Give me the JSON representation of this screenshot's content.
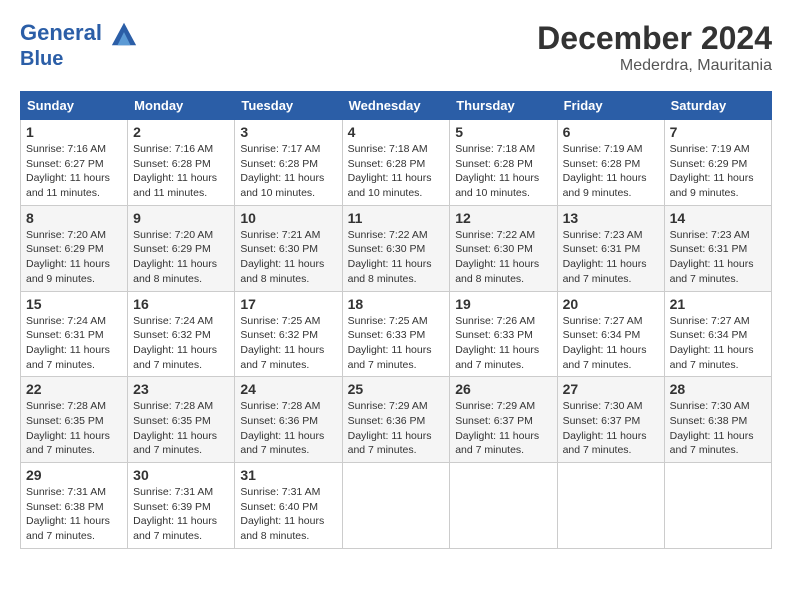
{
  "header": {
    "logo_line1": "General",
    "logo_line2": "Blue",
    "month": "December 2024",
    "location": "Mederdra, Mauritania"
  },
  "days_of_week": [
    "Sunday",
    "Monday",
    "Tuesday",
    "Wednesday",
    "Thursday",
    "Friday",
    "Saturday"
  ],
  "weeks": [
    [
      {
        "day": "1",
        "sunrise": "7:16 AM",
        "sunset": "6:27 PM",
        "daylight": "11 hours and 11 minutes."
      },
      {
        "day": "2",
        "sunrise": "7:16 AM",
        "sunset": "6:28 PM",
        "daylight": "11 hours and 11 minutes."
      },
      {
        "day": "3",
        "sunrise": "7:17 AM",
        "sunset": "6:28 PM",
        "daylight": "11 hours and 10 minutes."
      },
      {
        "day": "4",
        "sunrise": "7:18 AM",
        "sunset": "6:28 PM",
        "daylight": "11 hours and 10 minutes."
      },
      {
        "day": "5",
        "sunrise": "7:18 AM",
        "sunset": "6:28 PM",
        "daylight": "11 hours and 10 minutes."
      },
      {
        "day": "6",
        "sunrise": "7:19 AM",
        "sunset": "6:28 PM",
        "daylight": "11 hours and 9 minutes."
      },
      {
        "day": "7",
        "sunrise": "7:19 AM",
        "sunset": "6:29 PM",
        "daylight": "11 hours and 9 minutes."
      }
    ],
    [
      {
        "day": "8",
        "sunrise": "7:20 AM",
        "sunset": "6:29 PM",
        "daylight": "11 hours and 9 minutes."
      },
      {
        "day": "9",
        "sunrise": "7:20 AM",
        "sunset": "6:29 PM",
        "daylight": "11 hours and 8 minutes."
      },
      {
        "day": "10",
        "sunrise": "7:21 AM",
        "sunset": "6:30 PM",
        "daylight": "11 hours and 8 minutes."
      },
      {
        "day": "11",
        "sunrise": "7:22 AM",
        "sunset": "6:30 PM",
        "daylight": "11 hours and 8 minutes."
      },
      {
        "day": "12",
        "sunrise": "7:22 AM",
        "sunset": "6:30 PM",
        "daylight": "11 hours and 8 minutes."
      },
      {
        "day": "13",
        "sunrise": "7:23 AM",
        "sunset": "6:31 PM",
        "daylight": "11 hours and 7 minutes."
      },
      {
        "day": "14",
        "sunrise": "7:23 AM",
        "sunset": "6:31 PM",
        "daylight": "11 hours and 7 minutes."
      }
    ],
    [
      {
        "day": "15",
        "sunrise": "7:24 AM",
        "sunset": "6:31 PM",
        "daylight": "11 hours and 7 minutes."
      },
      {
        "day": "16",
        "sunrise": "7:24 AM",
        "sunset": "6:32 PM",
        "daylight": "11 hours and 7 minutes."
      },
      {
        "day": "17",
        "sunrise": "7:25 AM",
        "sunset": "6:32 PM",
        "daylight": "11 hours and 7 minutes."
      },
      {
        "day": "18",
        "sunrise": "7:25 AM",
        "sunset": "6:33 PM",
        "daylight": "11 hours and 7 minutes."
      },
      {
        "day": "19",
        "sunrise": "7:26 AM",
        "sunset": "6:33 PM",
        "daylight": "11 hours and 7 minutes."
      },
      {
        "day": "20",
        "sunrise": "7:27 AM",
        "sunset": "6:34 PM",
        "daylight": "11 hours and 7 minutes."
      },
      {
        "day": "21",
        "sunrise": "7:27 AM",
        "sunset": "6:34 PM",
        "daylight": "11 hours and 7 minutes."
      }
    ],
    [
      {
        "day": "22",
        "sunrise": "7:28 AM",
        "sunset": "6:35 PM",
        "daylight": "11 hours and 7 minutes."
      },
      {
        "day": "23",
        "sunrise": "7:28 AM",
        "sunset": "6:35 PM",
        "daylight": "11 hours and 7 minutes."
      },
      {
        "day": "24",
        "sunrise": "7:28 AM",
        "sunset": "6:36 PM",
        "daylight": "11 hours and 7 minutes."
      },
      {
        "day": "25",
        "sunrise": "7:29 AM",
        "sunset": "6:36 PM",
        "daylight": "11 hours and 7 minutes."
      },
      {
        "day": "26",
        "sunrise": "7:29 AM",
        "sunset": "6:37 PM",
        "daylight": "11 hours and 7 minutes."
      },
      {
        "day": "27",
        "sunrise": "7:30 AM",
        "sunset": "6:37 PM",
        "daylight": "11 hours and 7 minutes."
      },
      {
        "day": "28",
        "sunrise": "7:30 AM",
        "sunset": "6:38 PM",
        "daylight": "11 hours and 7 minutes."
      }
    ],
    [
      {
        "day": "29",
        "sunrise": "7:31 AM",
        "sunset": "6:38 PM",
        "daylight": "11 hours and 7 minutes."
      },
      {
        "day": "30",
        "sunrise": "7:31 AM",
        "sunset": "6:39 PM",
        "daylight": "11 hours and 7 minutes."
      },
      {
        "day": "31",
        "sunrise": "7:31 AM",
        "sunset": "6:40 PM",
        "daylight": "11 hours and 8 minutes."
      },
      null,
      null,
      null,
      null
    ]
  ],
  "labels": {
    "sunrise": "Sunrise:",
    "sunset": "Sunset:",
    "daylight": "Daylight:"
  }
}
